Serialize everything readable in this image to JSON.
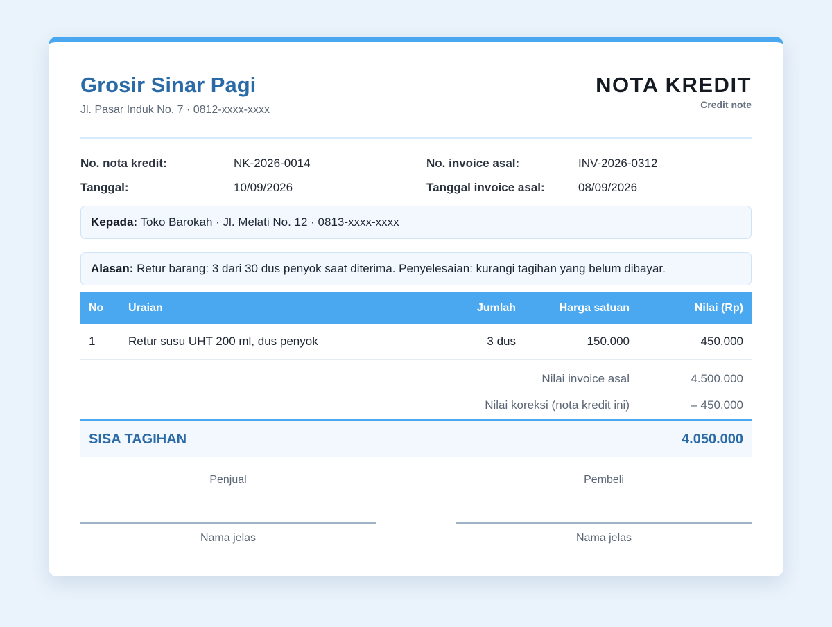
{
  "company": {
    "name": "Grosir Sinar Pagi",
    "address": "Jl. Pasar Induk No. 7 · 0812-xxxx-xxxx"
  },
  "document": {
    "title": "NOTA KREDIT",
    "subtitle": "Credit note"
  },
  "meta": {
    "credit_note_no_label": "No. nota kredit:",
    "credit_note_no": "NK-2026-0014",
    "date_label": "Tanggal:",
    "date": "10/09/2026",
    "original_invoice_label": "No. invoice asal:",
    "original_invoice": "INV-2026-0312",
    "original_invoice_date_label": "Tanggal invoice asal:",
    "original_invoice_date": "08/09/2026"
  },
  "recipient": {
    "label": "Kepada:",
    "text": "Toko Barokah · Jl. Melati No. 12 · 0813-xxxx-xxxx"
  },
  "reason": {
    "label": "Alasan:",
    "text": "Retur barang: 3 dari 30 dus penyok saat diterima. Penyelesaian: kurangi tagihan yang belum dibayar."
  },
  "table": {
    "headers": {
      "no": "No",
      "description": "Uraian",
      "quantity": "Jumlah",
      "unit_price": "Harga satuan",
      "amount": "Nilai (Rp)"
    },
    "rows": [
      {
        "no": "1",
        "description": "Retur susu UHT 200 ml, dus penyok",
        "quantity": "3 dus",
        "unit_price": "150.000",
        "amount": "450.000"
      }
    ]
  },
  "summary": {
    "original_value_label": "Nilai invoice asal",
    "original_value": "4.500.000",
    "correction_label": "Nilai koreksi (nota kredit ini)",
    "correction_value": "– 450.000",
    "balance_label": "SISA TAGIHAN",
    "balance_value": "4.050.000"
  },
  "signatures": {
    "seller_label": "Penjual",
    "seller_name_caption": "Nama jelas",
    "buyer_label": "Pembeli",
    "buyer_name_caption": "Nama jelas"
  },
  "colors": {
    "accent": "#4aa8f0",
    "heading": "#2a6aa6",
    "background": "#eaf3fb"
  }
}
